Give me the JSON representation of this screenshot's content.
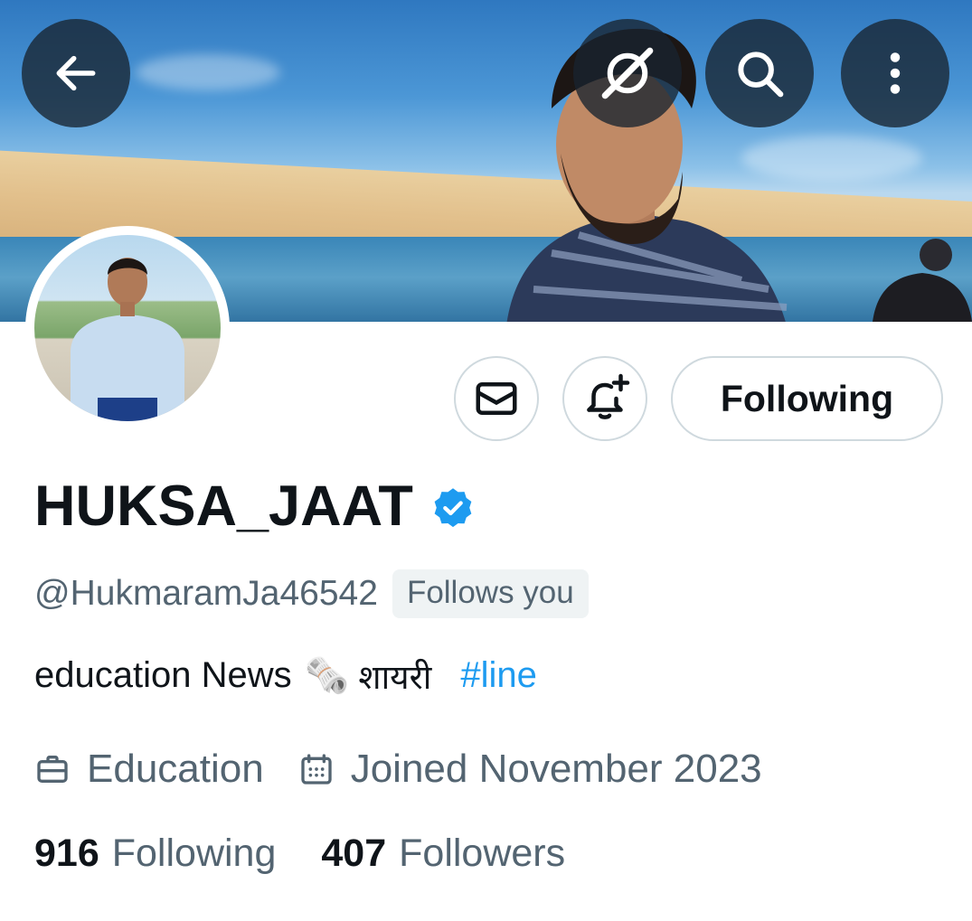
{
  "header": {
    "back_icon": "arrow-left-icon",
    "grok_icon": "grok-icon",
    "search_icon": "search-icon",
    "more_icon": "more-vertical-icon"
  },
  "actions": {
    "message_icon": "mail-icon",
    "notify_icon": "bell-plus-icon",
    "follow_label": "Following"
  },
  "profile": {
    "name": "HUKSA_JAAT",
    "verified_icon": "verified-badge-icon",
    "handle": "@HukmaramJa46542",
    "follows_you": "Follows you",
    "bio": {
      "text": "education News",
      "emoji": "🗞️",
      "hindi": "शायरी",
      "hashtag": "#line"
    },
    "category_icon": "briefcase-icon",
    "category": "Education",
    "joined_icon": "calendar-icon",
    "joined": "Joined November 2023",
    "following_count": "916",
    "following_label": "Following",
    "followers_count": "407",
    "followers_label": "Followers"
  },
  "colors": {
    "accent": "#1d9bf0",
    "secondary_text": "#536471",
    "primary_text": "#0f1419",
    "border": "#cfd9de"
  }
}
